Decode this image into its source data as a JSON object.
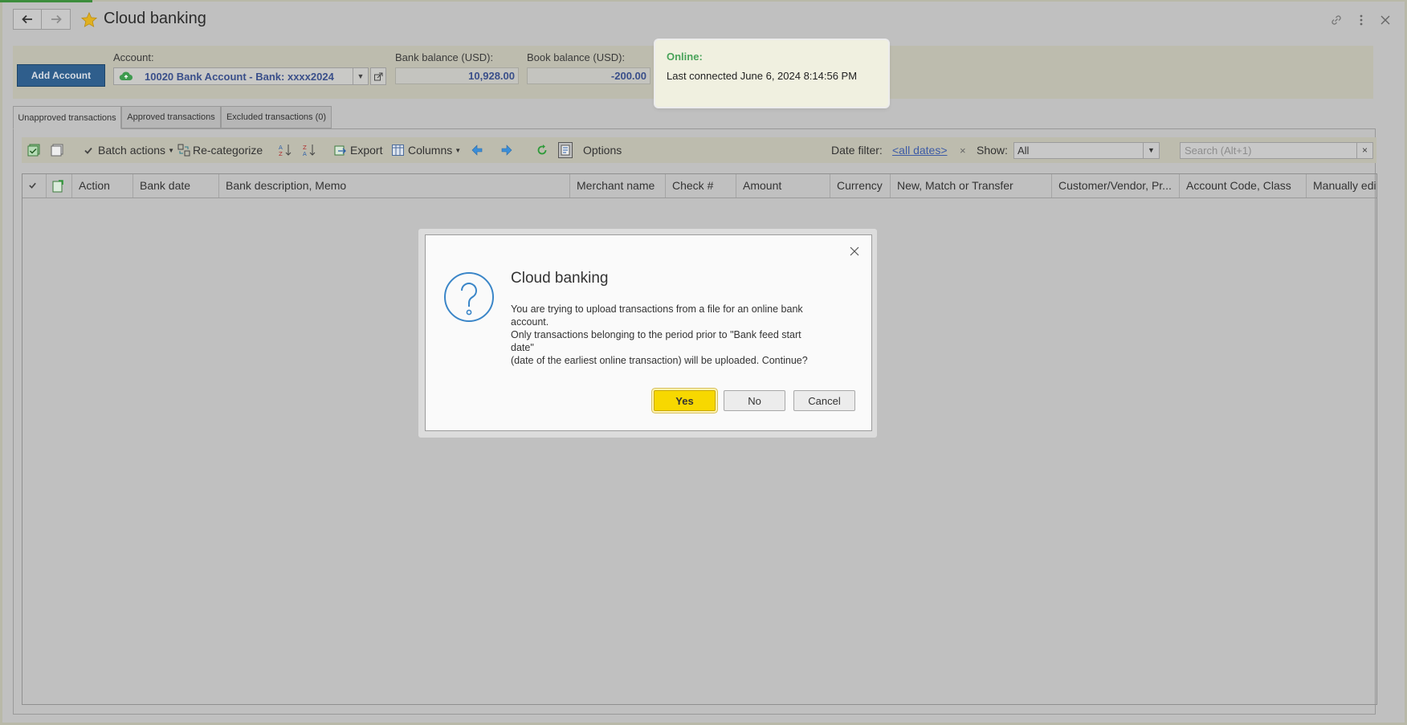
{
  "window": {
    "title": "Cloud banking"
  },
  "header": {
    "add_account_label": "Add Account",
    "account_label": "Account:",
    "account_value": "10020 Bank Account - Bank: xxxx2024",
    "bank_balance_label": "Bank balance (USD):",
    "bank_balance_value": "10,928.00",
    "book_balance_label": "Book balance (USD):",
    "book_balance_value": "-200.00"
  },
  "online": {
    "status": "Online:",
    "last_connected": "Last connected June 6, 2024 8:14:56 PM"
  },
  "tabs": [
    {
      "label": "Unapproved transactions",
      "active": true
    },
    {
      "label": "Approved transactions",
      "active": false
    },
    {
      "label": "Excluded transactions (0)",
      "active": false
    }
  ],
  "toolbar": {
    "batch_actions": "Batch actions",
    "recategorize": "Re-categorize",
    "export": "Export",
    "columns": "Columns",
    "options": "Options",
    "date_filter_label": "Date filter:",
    "date_filter_value": "<all dates>",
    "clear_date": "×",
    "show_label": "Show:",
    "show_value": "All",
    "search_placeholder": "Search (Alt+1)",
    "search_clear": "×"
  },
  "table": {
    "columns": [
      "Action",
      "Bank date",
      "Bank description, Memo",
      "Merchant name",
      "Check #",
      "Amount",
      "Currency",
      "New, Match or Transfer",
      "Customer/Vendor, Pr...",
      "Account Code, Class",
      "Manually edited"
    ]
  },
  "dialog": {
    "title": "Cloud banking",
    "message_lines": [
      "You are trying to upload transactions from a file for an online bank",
      "account.",
      "Only transactions belonging to the period prior to \"Bank feed start",
      "date\"",
      "(date of the earliest online transaction) will be uploaded. Continue?"
    ],
    "yes_label": "Yes",
    "no_label": "No",
    "cancel_label": "Cancel"
  },
  "colors": {
    "background": "#c0c0c0",
    "accent_blue": "#2f5e8c",
    "online_green": "#49a35a",
    "primary_yellow": "#f7d800",
    "link_blue": "#3d5ba6"
  }
}
